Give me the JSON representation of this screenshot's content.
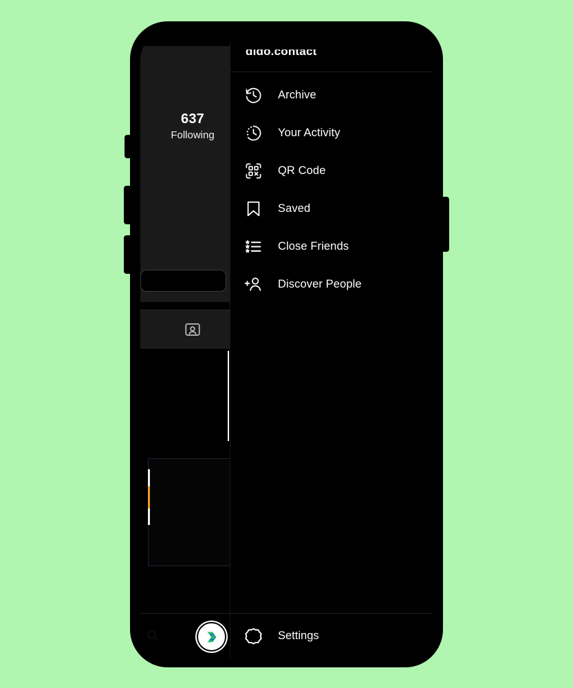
{
  "background": {
    "color": "#b0f5b0"
  },
  "device": {
    "name": "smartphone-mockup",
    "frame_color": "#000000",
    "buttons": [
      "mute-switch",
      "volume-up",
      "volume-down",
      "power"
    ]
  },
  "profile": {
    "stat": {
      "count": "637",
      "label": "Following"
    },
    "edit_profile_label": "",
    "tabs": [
      {
        "name": "tagged",
        "icon": "tagged-photos-icon"
      }
    ],
    "bottom_nav": [
      {
        "name": "search",
        "icon": "search-icon"
      },
      {
        "name": "profile-avatar",
        "icon": "avatar-icon"
      }
    ]
  },
  "menu": {
    "header": {
      "username": "dido.contact"
    },
    "items": [
      {
        "label": "Archive",
        "icon": "archive-clock-icon"
      },
      {
        "label": "Your Activity",
        "icon": "activity-clock-icon"
      },
      {
        "label": "QR Code",
        "icon": "qr-code-icon"
      },
      {
        "label": "Saved",
        "icon": "bookmark-icon"
      },
      {
        "label": "Close Friends",
        "icon": "star-list-icon"
      },
      {
        "label": "Discover People",
        "icon": "person-plus-icon"
      }
    ],
    "footer": {
      "label": "Settings",
      "icon": "gear-icon"
    }
  },
  "colors": {
    "panel_bg": "#000000",
    "card_bg": "#1a1a1a",
    "divider": "#1f1f1f",
    "text": "#ffffff",
    "accent_green": "#23c46a",
    "accent_orange": "#e8a020"
  }
}
